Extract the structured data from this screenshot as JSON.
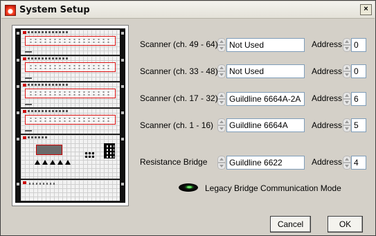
{
  "window": {
    "title": "System Setup",
    "close_glyph": "×"
  },
  "rows": [
    {
      "label": "Scanner (ch. 49 - 64)",
      "value": "Not Used",
      "address_label": "Address",
      "address": "0"
    },
    {
      "label": "Scanner (ch. 33 - 48)",
      "value": "Not Used",
      "address_label": "Address",
      "address": "0"
    },
    {
      "label": "Scanner (ch. 17 - 32)",
      "value": "Guildline 6664A-2A",
      "address_label": "Address",
      "address": "6"
    },
    {
      "label": "Scanner (ch. 1 - 16)",
      "value": "Guildline 6664A",
      "address_label": "Address",
      "address": "5"
    },
    {
      "label": "Resistance Bridge",
      "value": "Guildline 6622",
      "address_label": "Address",
      "address": "4"
    }
  ],
  "legacy": {
    "label": "Legacy Bridge Communication Mode",
    "state": "on",
    "led_color": "#3fbf3f"
  },
  "buttons": {
    "cancel": "Cancel",
    "ok": "OK"
  },
  "icons": {
    "app": "app-icon",
    "close": "close-icon",
    "spin": "spin-buttons-icon",
    "led": "led-indicator-icon"
  }
}
